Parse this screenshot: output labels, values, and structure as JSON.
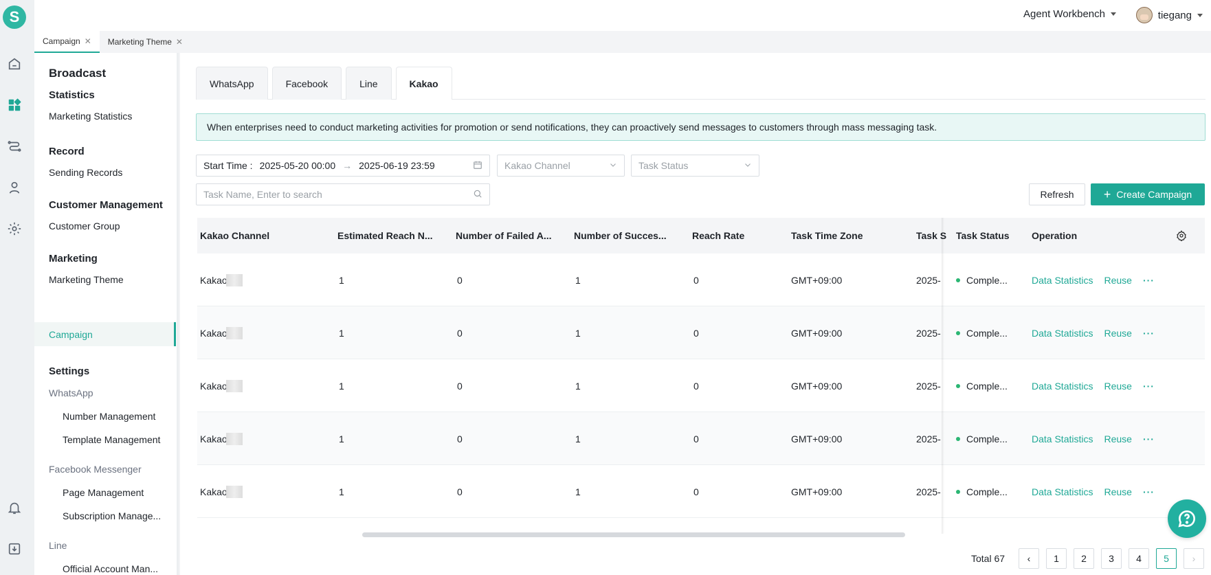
{
  "topbar": {
    "workbench_label": "Agent Workbench",
    "username": "tiegang"
  },
  "page_tabs": [
    {
      "label": "Campaign"
    },
    {
      "label": "Marketing Theme"
    }
  ],
  "sidebar": {
    "title": "Broadcast",
    "statistics_group": "Statistics",
    "marketing_statistics": "Marketing Statistics",
    "record_group": "Record",
    "sending_records": "Sending Records",
    "customer_mgmt_group": "Customer Management",
    "customer_group": "Customer Group",
    "marketing_group": "Marketing",
    "marketing_theme": "Marketing Theme",
    "campaign": "Campaign",
    "settings_group": "Settings",
    "whatsapp": "WhatsApp",
    "number_management": "Number Management",
    "template_management": "Template Management",
    "facebook_messenger": "Facebook Messenger",
    "page_management": "Page Management",
    "subscription_management": "Subscription Manage...",
    "line": "Line",
    "official_account": "Official Account Man..."
  },
  "channel_tabs": [
    {
      "label": "WhatsApp"
    },
    {
      "label": "Facebook"
    },
    {
      "label": "Line"
    },
    {
      "label": "Kakao"
    }
  ],
  "notice": "When enterprises need to conduct marketing activities for promotion or send notifications, they can proactively send messages to customers through mass messaging task.",
  "filters": {
    "start_time_label": "Start Time :",
    "start_value": "2025-05-20 00:00",
    "end_value": "2025-06-19 23:59",
    "channel_placeholder": "Kakao Channel",
    "status_placeholder": "Task Status",
    "search_placeholder": "Task Name, Enter to search"
  },
  "buttons": {
    "refresh": "Refresh",
    "create": "Create Campaign"
  },
  "table": {
    "headers": {
      "channel": "Kakao Channel",
      "estimated": "Estimated Reach N...",
      "failed": "Number of Failed A...",
      "success": "Number of Succes...",
      "reach_rate": "Reach Rate",
      "timezone": "Task Time Zone",
      "task_s": "Task S",
      "status": "Task Status",
      "operation": "Operation"
    },
    "rows": [
      {
        "channel": "Kakao",
        "estimated": "1",
        "failed": "0",
        "success": "1",
        "reach_rate": "0",
        "timezone": "GMT+09:00",
        "task_s": "2025-",
        "status": "Comple...",
        "op1": "Data Statistics",
        "op2": "Reuse",
        "more": "···"
      },
      {
        "channel": "Kakao",
        "estimated": "1",
        "failed": "0",
        "success": "1",
        "reach_rate": "0",
        "timezone": "GMT+09:00",
        "task_s": "2025-",
        "status": "Comple...",
        "op1": "Data Statistics",
        "op2": "Reuse",
        "more": "···"
      },
      {
        "channel": "Kakao",
        "estimated": "1",
        "failed": "0",
        "success": "1",
        "reach_rate": "0",
        "timezone": "GMT+09:00",
        "task_s": "2025-",
        "status": "Comple...",
        "op1": "Data Statistics",
        "op2": "Reuse",
        "more": "···"
      },
      {
        "channel": "Kakao",
        "estimated": "1",
        "failed": "0",
        "success": "1",
        "reach_rate": "0",
        "timezone": "GMT+09:00",
        "task_s": "2025-",
        "status": "Comple...",
        "op1": "Data Statistics",
        "op2": "Reuse",
        "more": "···"
      },
      {
        "channel": "Kakao",
        "estimated": "1",
        "failed": "0",
        "success": "1",
        "reach_rate": "0",
        "timezone": "GMT+09:00",
        "task_s": "2025-",
        "status": "Comple...",
        "op1": "Data Statistics",
        "op2": "Reuse",
        "more": "···"
      }
    ]
  },
  "pagination": {
    "total": "Total 67",
    "pages": [
      "1",
      "2",
      "3",
      "4",
      "5"
    ],
    "current": "5"
  },
  "colors": {
    "accent": "#1fa896",
    "status_complete": "#2bb673"
  }
}
